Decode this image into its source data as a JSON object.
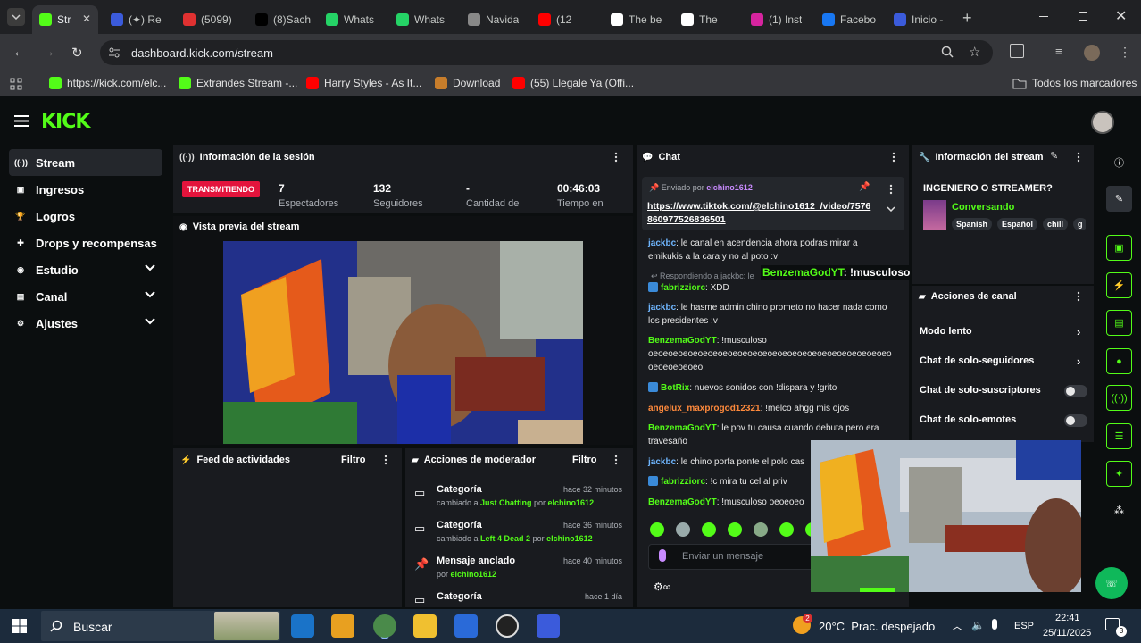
{
  "browser": {
    "tabs": [
      {
        "label": "Str",
        "favicon": "kick-icon",
        "color": "#53fc18",
        "active": true
      },
      {
        "label": "(✦) Re",
        "favicon": "app-icon",
        "color": "#3b5bdb"
      },
      {
        "label": "(5099)",
        "favicon": "app-icon",
        "color": "#e03131"
      },
      {
        "label": "(8)Sach",
        "favicon": "tiktok-icon",
        "color": "#000000"
      },
      {
        "label": "Whats",
        "favicon": "whatsapp-icon",
        "color": "#25d366"
      },
      {
        "label": "Whats",
        "favicon": "whatsapp-icon",
        "color": "#25d366"
      },
      {
        "label": "Navida",
        "favicon": "web-icon",
        "color": "#888888"
      },
      {
        "label": "(12",
        "favicon": "youtube-icon",
        "color": "#ff0000"
      },
      {
        "label": "The be",
        "favicon": "web-icon",
        "color": "#ffffff"
      },
      {
        "label": "The",
        "favicon": "web-icon",
        "color": "#ffffff"
      },
      {
        "label": "(1) Inst",
        "favicon": "instagram-icon",
        "color": "#d6249f"
      },
      {
        "label": "Facebo",
        "favicon": "facebook-icon",
        "color": "#1877f2"
      },
      {
        "label": "Inicio -",
        "favicon": "app-icon",
        "color": "#3b5bdb"
      }
    ],
    "url": "dashboard.kick.com/stream",
    "bookmarks": [
      {
        "label": "https://kick.com/elc...",
        "color": "#53fc18"
      },
      {
        "label": "Extrandes Stream -...",
        "color": "#53fc18"
      },
      {
        "label": "Harry Styles - As It...",
        "color": "#ff0000"
      },
      {
        "label": "Download",
        "color": "#c77d2b"
      },
      {
        "label": "(55) Llegale Ya (Offi...",
        "color": "#ff0000"
      }
    ],
    "all_bookmarks": "Todos los marcadores"
  },
  "kick": {
    "logo": "KICK",
    "sidebar": [
      {
        "label": "Stream",
        "icon": "stream-icon",
        "expandable": false
      },
      {
        "label": "Ingresos",
        "icon": "income-icon",
        "expandable": false
      },
      {
        "label": "Logros",
        "icon": "trophy-icon",
        "expandable": false
      },
      {
        "label": "Drops y recompensas",
        "icon": "gift-icon",
        "expandable": false
      },
      {
        "label": "Estudio",
        "icon": "studio-icon",
        "expandable": true
      },
      {
        "label": "Canal",
        "icon": "channel-icon",
        "expandable": true
      },
      {
        "label": "Ajustes",
        "icon": "settings-icon",
        "expandable": true
      }
    ],
    "session": {
      "title": "Información de la sesión",
      "live_badge": "TRANSMITIENDO",
      "stats": [
        {
          "value": "7",
          "label": "Espectadores"
        },
        {
          "value": "132",
          "label": "Seguidores"
        },
        {
          "value": "-",
          "label": "Cantidad de"
        },
        {
          "value": "00:46:03",
          "label": "Tiempo en"
        }
      ]
    },
    "preview_title": "Vista previa del stream",
    "feed": {
      "title": "Feed de actividades",
      "filter": "Filtro"
    },
    "mod": {
      "title": "Acciones de moderador",
      "filter": "Filtro",
      "items": [
        {
          "title": "Categoría",
          "pre": "cambiado a ",
          "target": "Just Chatting",
          "mid": " por ",
          "user": "elchino1612",
          "time": "hace 32 minutos",
          "icon": "category-icon"
        },
        {
          "title": "Categoría",
          "pre": "cambiado a ",
          "target": "Left 4 Dead 2",
          "mid": " por ",
          "user": "elchino1612",
          "time": "hace 36 minutos",
          "icon": "category-icon"
        },
        {
          "title": "Mensaje anclado",
          "pre": "por ",
          "target": "",
          "mid": "",
          "user": "elchino1612",
          "time": "hace 40 minutos",
          "icon": "pin-icon"
        },
        {
          "title": "Categoría",
          "pre": "",
          "target": "",
          "mid": "",
          "user": "",
          "time": "hace 1 día",
          "icon": "category-icon"
        }
      ]
    },
    "chat": {
      "title": "Chat",
      "pinned_by_label": "Enviado por",
      "pinned_user": "elchino1612",
      "pinned_link": "https://www.tiktok.com/@elchino1612_/video/7576860977526836501",
      "reply_label": "Respondiendo a jackbc: le",
      "overlay_user": "BenzemaGodYT",
      "overlay_text": ": !musculoso oeoeoeoeoeoeoeoeoeoeo",
      "messages": [
        {
          "user": "jackbc",
          "color": "#6fb6ff",
          "badge": false,
          "text": ": le canal en acendencia ahora podras mirar a emikukis a la cara y no al poto :v"
        },
        {
          "user": "fabrizziorc",
          "color": "#53fc18",
          "badge": true,
          "text": ": XDD"
        },
        {
          "user": "jackbc",
          "color": "#6fb6ff",
          "badge": false,
          "text": ": le hasme admin chino prometo no hacer nada como los presidentes :v"
        },
        {
          "user": "BenzemaGodYT",
          "color": "#53fc18",
          "badge": false,
          "text": ": !musculoso oeoeoeoeoeoeoeoeoeoeoeoeoeoeoeoeoeoeoeoeoeoeoeoeo oeoeoeoeoeo"
        },
        {
          "user": "BotRix",
          "color": "#53fc18",
          "badge": true,
          "text": ": nuevos sonidos con !dispara y !grito"
        },
        {
          "user": "angelux_maxprogod12321",
          "color": "#ff8a3c",
          "badge": false,
          "text": ": !melco ahgg mis ojos"
        },
        {
          "user": "BenzemaGodYT",
          "color": "#53fc18",
          "badge": false,
          "text": ": le pov tu causa cuando debuta pero era travesaño"
        },
        {
          "user": "jackbc",
          "color": "#6fb6ff",
          "badge": false,
          "text": ": le chino porfa ponte el polo cas"
        },
        {
          "user": "fabrizziorc",
          "color": "#53fc18",
          "badge": true,
          "text": ": !c mira tu cel al priv"
        },
        {
          "user": "BenzemaGodYT",
          "color": "#53fc18",
          "badge": false,
          "text": ": !musculoso oeoeoeo"
        }
      ],
      "input_placeholder": "Enviar un mensaje"
    },
    "stream_info": {
      "title": "Información del stream",
      "stream_title": "INGENIERO O STREAMER?",
      "category": "Conversando",
      "tags": [
        "Spanish",
        "Español",
        "chill",
        "g"
      ]
    },
    "channel_actions": {
      "title": "Acciones de canal",
      "items": [
        {
          "label": "Modo lento",
          "control": "chevron"
        },
        {
          "label": "Chat de solo-seguidores",
          "control": "chevron"
        },
        {
          "label": "Chat de solo-suscriptores",
          "control": "toggle"
        },
        {
          "label": "Chat de solo-emotes",
          "control": "toggle"
        }
      ]
    },
    "rail_icons": [
      "info-icon",
      "edit-icon",
      "camera-icon",
      "lightning-icon",
      "note-icon",
      "chat-bubble-icon",
      "broadcast-icon",
      "layers-icon",
      "wrench-icon",
      "share-icon",
      "support-icon"
    ]
  },
  "taskbar": {
    "search": "Buscar",
    "weather": "20°C  Prac. despejado",
    "weather_badge": "2",
    "lang": "ESP",
    "time": "22:41",
    "date": "25/11/2025",
    "notif_count": "3"
  }
}
